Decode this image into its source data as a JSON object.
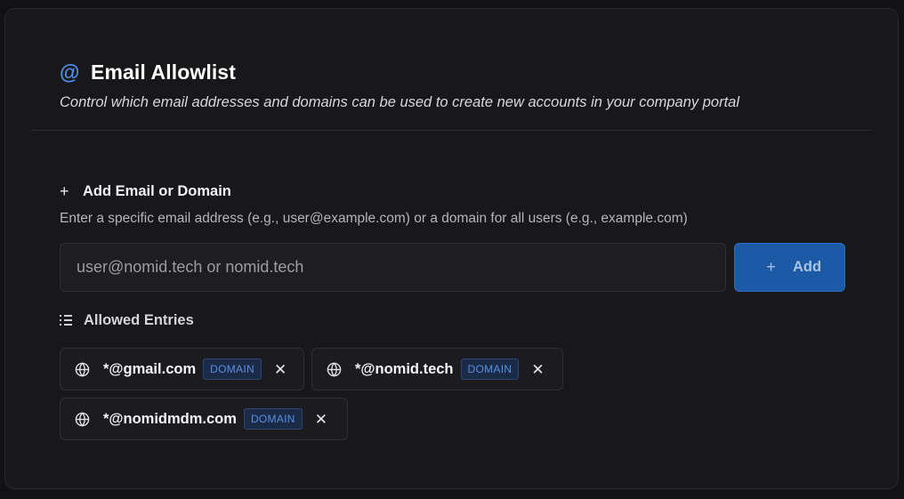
{
  "header": {
    "icon": "at-icon",
    "title": "Email Allowlist",
    "subtitle": "Control which email addresses and domains can be used to create new accounts in your company portal"
  },
  "add_section": {
    "icon": "plus-icon",
    "title": "Add Email or Domain",
    "hint": "Enter a specific email address (e.g., user@example.com) or a domain for all users (e.g., example.com)",
    "input_placeholder": "user@nomid.tech or nomid.tech",
    "input_value": "",
    "button_label": "Add",
    "button_icon": "plus-icon"
  },
  "entries": {
    "icon": "list-icon",
    "title": "Allowed Entries",
    "items": [
      {
        "value": "*@gmail.com",
        "type": "DOMAIN",
        "icon": "globe-icon"
      },
      {
        "value": "*@nomid.tech",
        "type": "DOMAIN",
        "icon": "globe-icon"
      },
      {
        "value": "*@nomidmdm.com",
        "type": "DOMAIN",
        "icon": "globe-icon"
      }
    ]
  },
  "colors": {
    "accent": "#1d5aa6",
    "at_icon": "#4d8fe6",
    "badge_text": "#5a8fe0",
    "card_bg": "#18181b"
  }
}
